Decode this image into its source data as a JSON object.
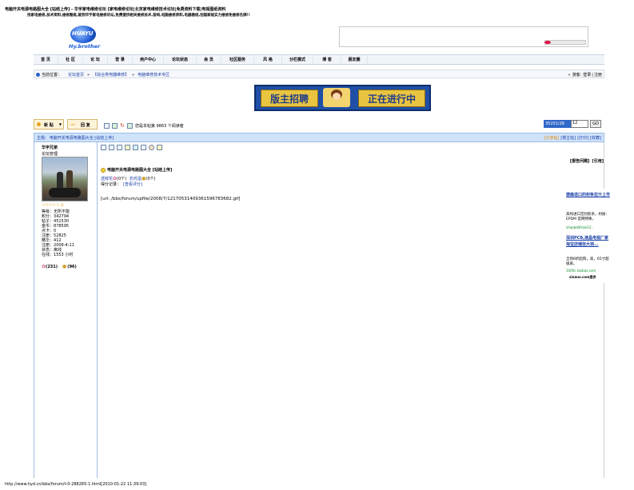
{
  "page": {
    "title_line": "电脑开关电源电路图大全 [站结上传] - 华宇家电维修论坛 [家电维修论坛|北京家电维修技术论坛|免费资料下载|电视图纸资料",
    "subtitle_line": "找家电维修,技术资料,维修图纸,就到华宇家电维修论坛,免费提供相关维修技术,音响,电脑维修资料,电器图纸,创国家级实力维修免维修名牌!!",
    "footer_url": "http://www.hyd.cn/bbs/forum/t-0-288265-1.html[2010-01-22 11:39:03]"
  },
  "logo": {
    "text": "HUAYU",
    "subtext": "Hy.brother"
  },
  "nav": {
    "items": [
      "首 页",
      "社 区",
      "论 坛",
      "登 录",
      "用户中心",
      "论坛状态",
      "会 员",
      "社区服务",
      "风 格",
      "分栏模式",
      "博 客",
      "朋友圈"
    ]
  },
  "breadcrumb": {
    "home": "当前位置：",
    "link1": "论坛首页",
    "link2": "【综合类电器维修】",
    "link3": "电脑维修技术专区",
    "right_label": "游客:",
    "login": "登录",
    "register": "注册"
  },
  "banner": {
    "left_text": "版主招聘",
    "right_text": "正在进行中"
  },
  "toolbar": {
    "new_post": "新 贴",
    "reply": "回 复",
    "readers": "您是本帖第 9863 个阅读者",
    "page_input": "35201/28",
    "page_num": "12",
    "go": "GO"
  },
  "thread": {
    "title_prefix": "主题:",
    "title": "电脑开关电源电路图大全 [站结上传]",
    "actions": [
      "[分享帖]",
      "[楼主帖]",
      "[打印]",
      "[收藏]"
    ]
  },
  "post": {
    "author_name": "华宇兄弟",
    "author_role": "论坛管理",
    "stats": [
      {
        "label": "等级：",
        "value": "无所不能"
      },
      {
        "label": "积分：",
        "value": "342794"
      },
      {
        "label": "帖子：",
        "value": "451530"
      },
      {
        "label": "金币：",
        "value": "878595"
      },
      {
        "label": "点卡：",
        "value": "0"
      },
      {
        "label": "注册：",
        "value": "52825"
      },
      {
        "label": "精华：",
        "value": "412"
      },
      {
        "label": "注册：",
        "value": "2008-4-11"
      },
      {
        "label": "状态：",
        "value": "离线"
      },
      {
        "label": "在线：",
        "value": "1553 小时"
      }
    ],
    "flowers": "(231)",
    "eggs": "(96)",
    "report": "[报告问题]",
    "quote": "[引用]",
    "post_title": "电脑开关电源电路图大全 [站结上传]",
    "send_flower": "送鲜花",
    "flower_count": "(0个)",
    "send_egg": "扔鸡蛋",
    "egg_count": "(0个)",
    "score_record": "得分记录：",
    "view_score": "[查看评分]",
    "url_text": "[url: /bbs/forum/upfile/2008/7/12170531409361596783682.gif]"
  },
  "ads": {
    "items": [
      {
        "title": "德森进口的封条拉什上市",
        "desc": "高纯进口宫封胶条，材质：EPDM 官网特殊，",
        "link": "shopbddfsize12.."
      },
      {
        "title": "深圳PCB,液晶电视厂家淘宝店铺信大领...",
        "desc": "全场6折起购，高，65寸超级屏。",
        "link": "1000c.taobao.com"
      }
    ],
    "footer": "sinans.com提供"
  }
}
